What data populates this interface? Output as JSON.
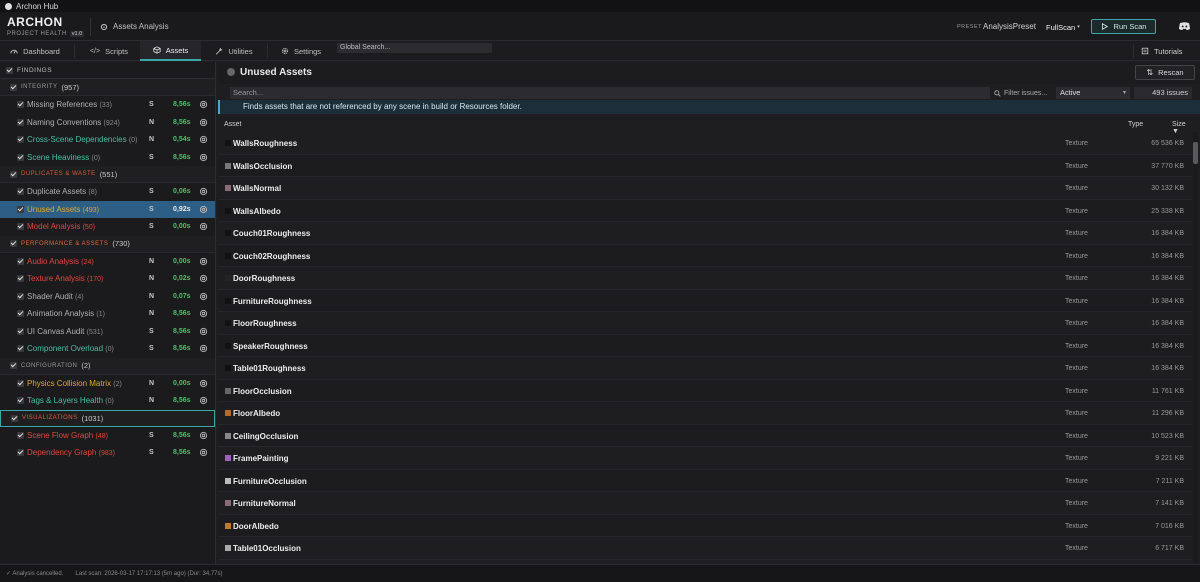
{
  "titlebar": {
    "title": "Archon Hub"
  },
  "header": {
    "brand": "ARCHON",
    "subtitle": "PROJECT HEALTH",
    "version": "v1.0",
    "page": "Assets Analysis",
    "preset_label": "PRESET",
    "preset_value": "AnalysisPreset",
    "mode": "FullScan",
    "run_label": "Run Scan"
  },
  "tabs": [
    {
      "label": "Dashboard",
      "icon": "gauge-icon"
    },
    {
      "label": "Scripts",
      "icon": "code-icon"
    },
    {
      "label": "Assets",
      "icon": "cube-icon",
      "active": true
    },
    {
      "label": "Utilities",
      "icon": "wrench-icon"
    },
    {
      "label": "Settings",
      "icon": "gear-icon"
    }
  ],
  "global_search": {
    "placeholder": "Global Search..."
  },
  "tutorials": {
    "label": "Tutorials"
  },
  "sidebar": {
    "findings": "FINDINGS",
    "groups": [
      {
        "label": "INTEGRITY",
        "count": "(957)",
        "items": [
          {
            "name": "Missing References",
            "count": "(33)",
            "sev": "S",
            "time": "8,56s",
            "color": "gray"
          },
          {
            "name": "Naming Conventions",
            "count": "(924)",
            "sev": "N",
            "time": "8,56s",
            "color": "gray"
          },
          {
            "name": "Cross-Scene Dependencies",
            "count": "(0)",
            "sev": "N",
            "time": "0,54s",
            "color": "teal"
          },
          {
            "name": "Scene Heaviness",
            "count": "(0)",
            "sev": "S",
            "time": "8,56s",
            "color": "teal"
          }
        ]
      },
      {
        "label": "DUPLICATES & WASTE",
        "count": "(551)",
        "items": [
          {
            "name": "Duplicate Assets",
            "count": "(8)",
            "sev": "S",
            "time": "0,06s",
            "color": "gray"
          },
          {
            "name": "Unused Assets",
            "count": "(493)",
            "sev": "S",
            "time": "0,92s",
            "color": "orange",
            "selected": true
          },
          {
            "name": "Model Analysis",
            "count": "(50)",
            "sev": "S",
            "time": "0,00s",
            "color": "red"
          }
        ]
      },
      {
        "label": "PERFORMANCE & ASSETS",
        "count": "(730)",
        "items": [
          {
            "name": "Audio Analysis",
            "count": "(24)",
            "sev": "N",
            "time": "0,00s",
            "color": "red"
          },
          {
            "name": "Texture Analysis",
            "count": "(170)",
            "sev": "N",
            "time": "0,02s",
            "color": "red"
          },
          {
            "name": "Shader Audit",
            "count": "(4)",
            "sev": "N",
            "time": "0,07s",
            "color": "gray"
          },
          {
            "name": "Animation Analysis",
            "count": "(1)",
            "sev": "N",
            "time": "8,56s",
            "color": "gray"
          },
          {
            "name": "UI Canvas Audit",
            "count": "(531)",
            "sev": "S",
            "time": "8,56s",
            "color": "gray"
          },
          {
            "name": "Component Overload",
            "count": "(0)",
            "sev": "S",
            "time": "8,56s",
            "color": "teal"
          }
        ]
      },
      {
        "label": "CONFIGURATION",
        "count": "(2)",
        "items": [
          {
            "name": "Physics Collision Matrix",
            "count": "(2)",
            "sev": "N",
            "time": "0,00s",
            "color": "orange"
          },
          {
            "name": "Tags & Layers Health",
            "count": "(0)",
            "sev": "N",
            "time": "8,56s",
            "color": "teal"
          }
        ]
      },
      {
        "label": "VISUALIZATIONS",
        "count": "(1031)",
        "items": [
          {
            "name": "Scene Flow Graph",
            "count": "(48)",
            "sev": "S",
            "time": "8,56s",
            "color": "red"
          },
          {
            "name": "Dependency Graph",
            "count": "(983)",
            "sev": "S",
            "time": "8,56s",
            "color": "red"
          }
        ]
      }
    ]
  },
  "main": {
    "title": "Unused Assets",
    "rescan_label": "Rescan",
    "search_placeholder": "Search...",
    "filter_label": "Filter issues...",
    "status": "Active",
    "issues": "493 issues",
    "description": "Finds assets that are not referenced by any scene in build or Resources folder.",
    "columns": {
      "asset": "Asset",
      "type": "Type",
      "size": "Size"
    },
    "rows": [
      {
        "name": "WallsRoughness",
        "type": "Texture",
        "size": "65 536 KB",
        "thumb": "#111111"
      },
      {
        "name": "WallsOcclusion",
        "type": "Texture",
        "size": "37 770 KB",
        "thumb": "#777777"
      },
      {
        "name": "WallsNormal",
        "type": "Texture",
        "size": "30 132 KB",
        "thumb": "#8a6a78"
      },
      {
        "name": "WallsAlbedo",
        "type": "Texture",
        "size": "25 338 KB",
        "thumb": "#111111"
      },
      {
        "name": "Couch01Roughness",
        "type": "Texture",
        "size": "16 384 KB",
        "thumb": "#111111"
      },
      {
        "name": "Couch02Roughness",
        "type": "Texture",
        "size": "16 384 KB",
        "thumb": "#111111"
      },
      {
        "name": "DoorRoughness",
        "type": "Texture",
        "size": "16 384 KB",
        "thumb": "#222222"
      },
      {
        "name": "FurnitureRoughness",
        "type": "Texture",
        "size": "16 384 KB",
        "thumb": "#111111"
      },
      {
        "name": "FloorRoughness",
        "type": "Texture",
        "size": "16 384 KB",
        "thumb": "#111111"
      },
      {
        "name": "SpeakerRoughness",
        "type": "Texture",
        "size": "16 384 KB",
        "thumb": "#111111"
      },
      {
        "name": "Table01Roughness",
        "type": "Texture",
        "size": "16 384 KB",
        "thumb": "#111111"
      },
      {
        "name": "FloorOcclusion",
        "type": "Texture",
        "size": "11 761 KB",
        "thumb": "#666666"
      },
      {
        "name": "FloorAlbedo",
        "type": "Texture",
        "size": "11 296 KB",
        "thumb": "#b86a2a"
      },
      {
        "name": "CeilingOcclusion",
        "type": "Texture",
        "size": "10 523 KB",
        "thumb": "#888888"
      },
      {
        "name": "FramePainting",
        "type": "Texture",
        "size": "9 221 KB",
        "thumb": "#a060c0"
      },
      {
        "name": "FurnitureOcclusion",
        "type": "Texture",
        "size": "7 211 KB",
        "thumb": "#bbbbbb"
      },
      {
        "name": "FurnitureNormal",
        "type": "Texture",
        "size": "7 141 KB",
        "thumb": "#8a6a78"
      },
      {
        "name": "DoorAlbedo",
        "type": "Texture",
        "size": "7 016 KB",
        "thumb": "#c07a2a"
      },
      {
        "name": "Table01Occlusion",
        "type": "Texture",
        "size": "6 717 KB",
        "thumb": "#aaaaaa"
      }
    ]
  },
  "statusbar": {
    "status": "Analysis cancelled.",
    "last_scan": "Last scan: 2026-03-17 17:17:13 (5m ago) (Dur: 34,77s)"
  },
  "colors": {
    "accent": "#3aa8a8",
    "selected_row": "#2d5e86",
    "ok_green": "#4cc06a",
    "error_red": "#e0483a",
    "warn_orange": "#e0a830"
  }
}
